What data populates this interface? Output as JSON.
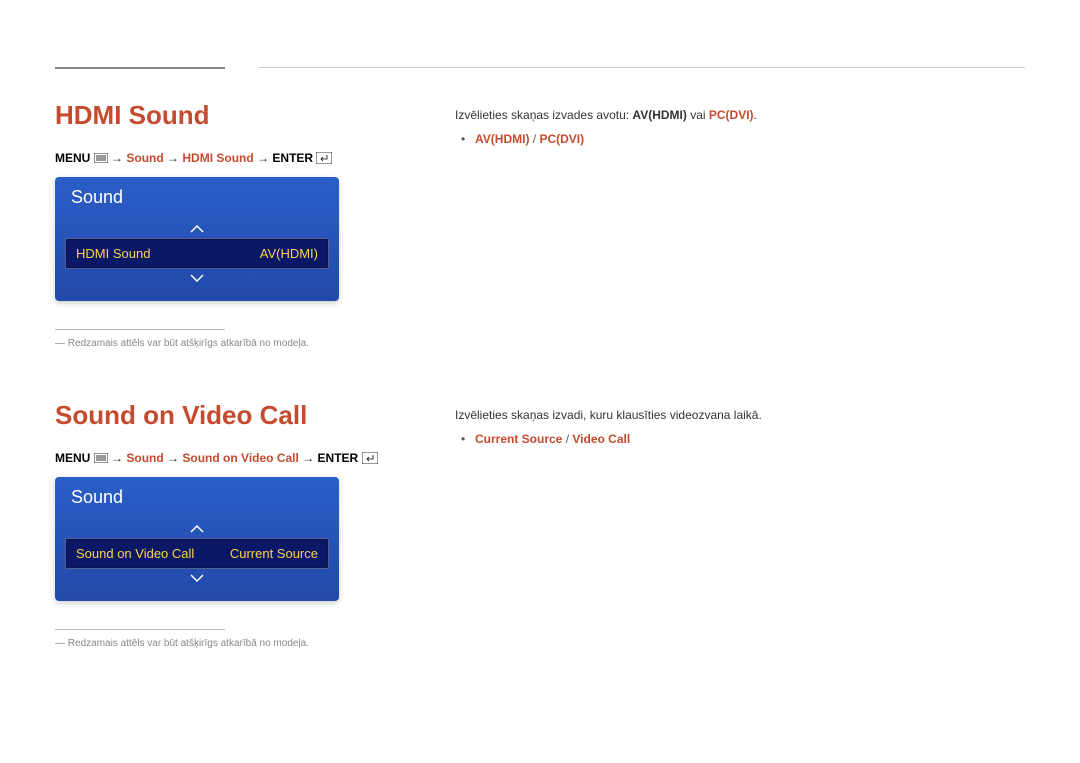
{
  "section1": {
    "title": "HDMI Sound",
    "path": {
      "pre": "MENU",
      "seg1": "Sound",
      "seg2": "HDMI Sound",
      "post": "ENTER"
    },
    "osd": {
      "title": "Sound",
      "row_label": "HDMI Sound",
      "row_value": "AV(HDMI)"
    },
    "footnote": "Redzamais attēls var būt atšķirīgs atkarībā no modeļa.",
    "desc": {
      "pre": "Izvēlieties skaņas izvades avotu: ",
      "opt1": "AV(HDMI)",
      "mid": " vai ",
      "opt2": "PC(DVI)",
      "post": "."
    },
    "bullet": {
      "a": "AV(HDMI)",
      "sep": " / ",
      "b": "PC(DVI)"
    }
  },
  "section2": {
    "title": "Sound on Video Call",
    "path": {
      "pre": "MENU",
      "seg1": "Sound",
      "seg2": "Sound on Video Call",
      "post": "ENTER"
    },
    "osd": {
      "title": "Sound",
      "row_label": "Sound on Video Call",
      "row_value": "Current Source"
    },
    "footnote": "Redzamais attēls var būt atšķirīgs atkarībā no modeļa.",
    "desc": "Izvēlieties skaņas izvadi, kuru klausīties videozvana laikā.",
    "bullet": {
      "a": "Current Source",
      "sep": " / ",
      "b": "Video Call"
    }
  }
}
